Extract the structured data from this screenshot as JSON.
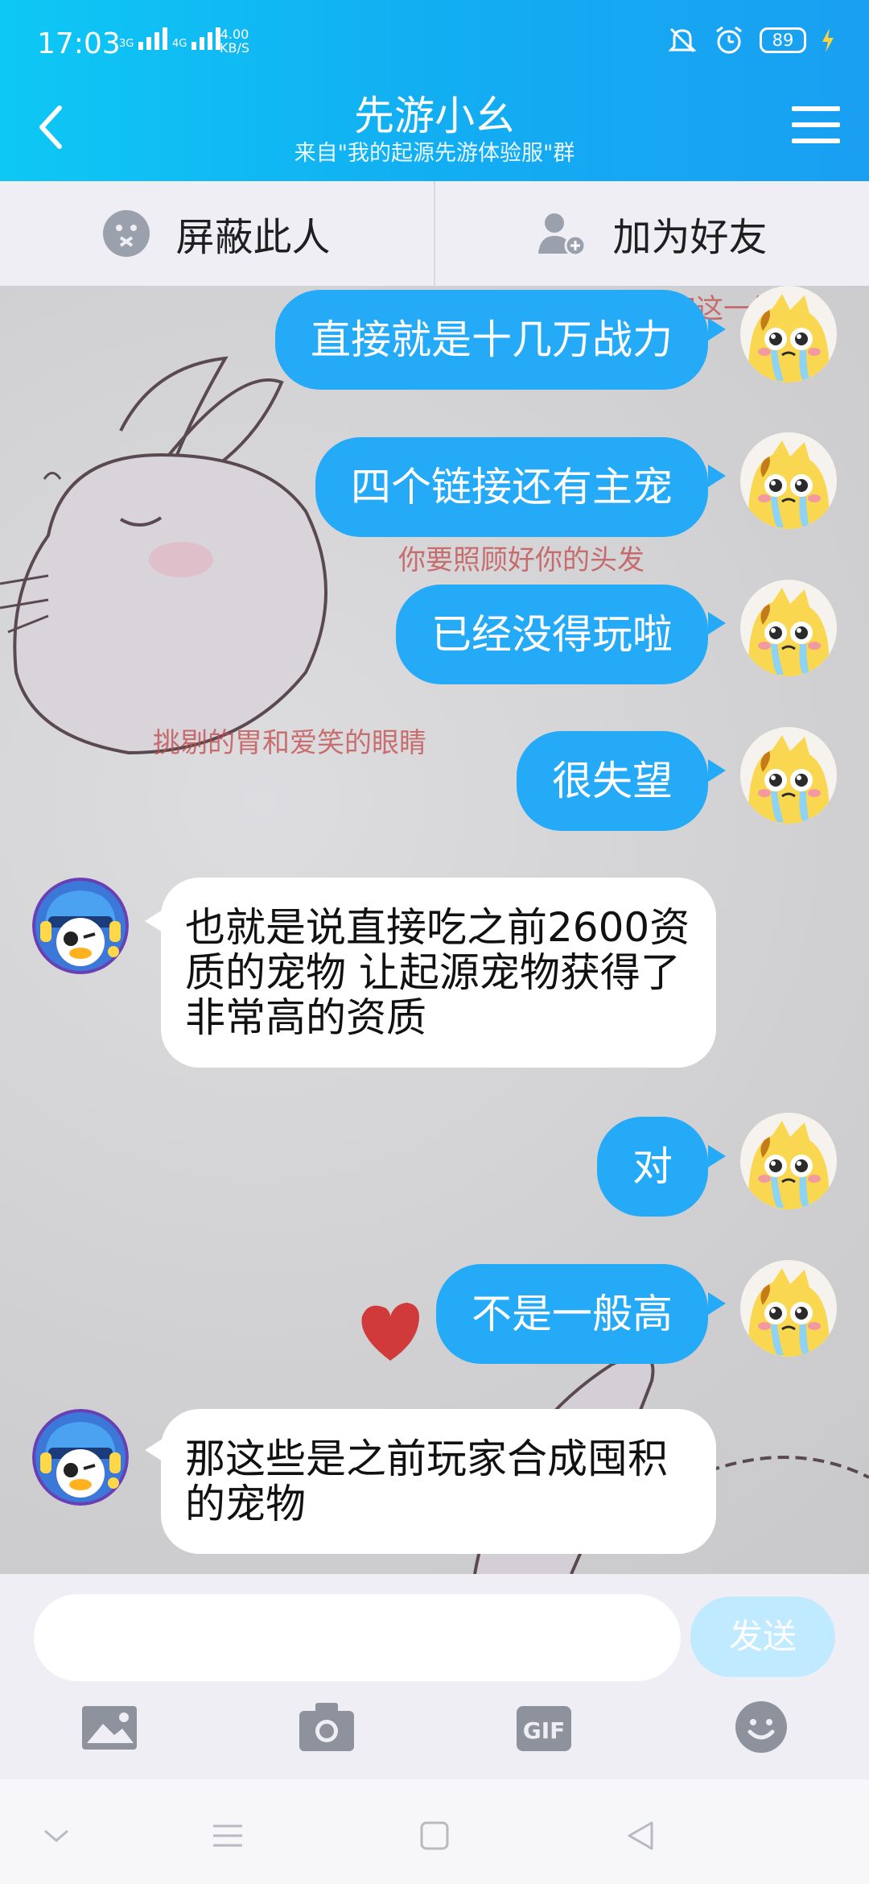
{
  "status_bar": {
    "time": "17:03",
    "net1": "3G",
    "net2": "4G",
    "speed_value": "4.00",
    "speed_unit": "KB/S",
    "battery": "89"
  },
  "header": {
    "title": "先游小幺",
    "subtitle": "来自\"我的起源先游体验服\"群"
  },
  "actions": {
    "block": "屏蔽此人",
    "add_friend": "加为好友"
  },
  "background_text": {
    "line1": "醒来后能酩酊大醉过完这一生",
    "line2": "你要照顾好你的头发",
    "line3": "挑剔的胃和爱笑的眼睛"
  },
  "messages": [
    {
      "side": "me",
      "text": "直接就是十几万战力"
    },
    {
      "side": "me",
      "text": "四个链接还有主宠"
    },
    {
      "side": "me",
      "text": "已经没得玩啦"
    },
    {
      "side": "me",
      "text": "很失望"
    },
    {
      "side": "them",
      "text": "也就是说直接吃之前2600资质的宠物 让起源宠物获得了非常高的资质"
    },
    {
      "side": "me",
      "text": "对"
    },
    {
      "side": "me",
      "text": "不是一般高"
    },
    {
      "side": "them",
      "text": "那这些是之前玩家合成囤积的宠物"
    }
  ],
  "input": {
    "placeholder": "",
    "send_label": "发送"
  },
  "colors": {
    "header_start": "#0ec8f4",
    "header_end": "#1a9ff2",
    "my_bubble": "#24aaf7",
    "their_bubble": "#ffffff",
    "send_disabled": "#bfeaff"
  }
}
